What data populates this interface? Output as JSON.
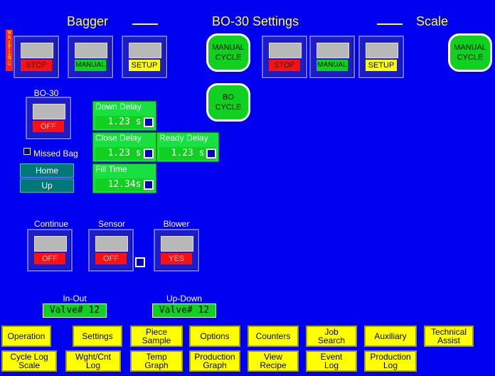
{
  "header": {
    "left": "Bagger",
    "center": "BO-30 Settings",
    "right": "Scale"
  },
  "status": {
    "waiting": "WAITING"
  },
  "bagger": {
    "stop": "STOP",
    "manual": "MANUAL",
    "setup": "SETUP",
    "manual_cycle": "MANUAL\nCYCLE",
    "bo_cycle": "BO\nCYCLE"
  },
  "scale": {
    "stop": "STOP",
    "manual": "MANUAL",
    "setup": "SETUP",
    "manual_cycle": "MANUAL\nCYCLE"
  },
  "bo30": {
    "label": "BO-30",
    "state": "OFF"
  },
  "delays": {
    "down": {
      "label": "Down Delay",
      "value": "1.23 s"
    },
    "close": {
      "label": "Close Delay",
      "value": "1.23 s"
    },
    "ready": {
      "label": "Ready Delay",
      "value": "1.23 s"
    },
    "fill": {
      "label": "Fill Time",
      "value": "12.34s"
    }
  },
  "missed_bag": "Missed Bag",
  "home": "Home",
  "up": "Up",
  "continue": {
    "label": "Continue",
    "state": "OFF"
  },
  "sensor": {
    "label": "Sensor",
    "state": "OFF"
  },
  "blower": {
    "label": "Blower",
    "state": "YES"
  },
  "inout": {
    "label": "In-Out",
    "value": "Valve# 12"
  },
  "updown": {
    "label": "Up-Down",
    "value": "Valve# 12"
  },
  "tabs_row1": [
    "Operation",
    "Settings",
    "Piece\nSample",
    "Options",
    "Counters",
    "Job\nSearch",
    "Auxiliary",
    "Technical\nAssist"
  ],
  "tabs_row2": [
    "Cycle Log\nScale",
    "Wght/Cnt\nLog",
    "Temp\nGraph",
    "Production\nGraph",
    "View\nRecipe",
    "Event\nLog",
    "Production\nLog"
  ],
  "colors": {
    "background": "#0000f0",
    "accent": "#ffff00",
    "green": "#10d020",
    "red": "#ff1010"
  }
}
